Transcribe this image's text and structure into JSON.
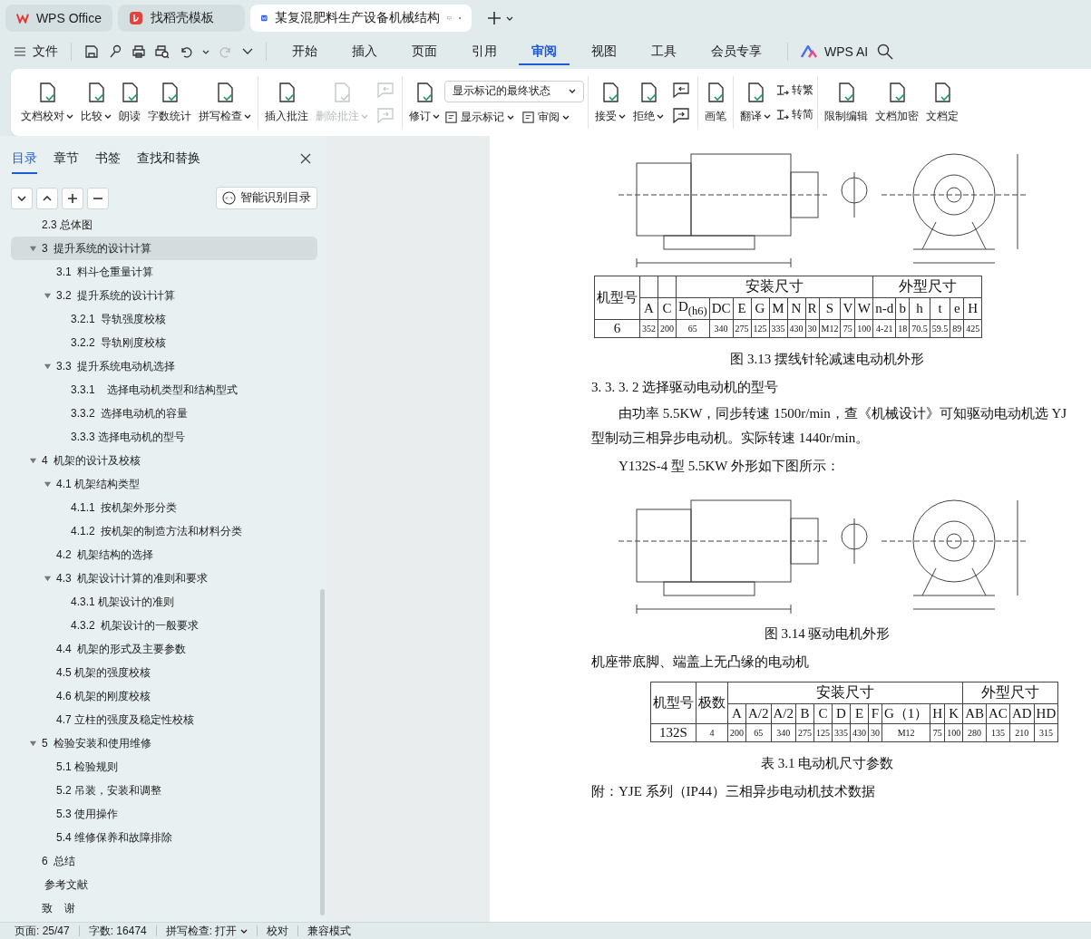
{
  "tabs": [
    {
      "label": "WPS Office",
      "kind": "home",
      "selected": false
    },
    {
      "label": "找稻壳模板",
      "kind": "template",
      "selected": false
    },
    {
      "label": "某复混肥料生产设备机械结构",
      "kind": "doc",
      "selected": true
    }
  ],
  "menu": {
    "file": "文件",
    "tabs": [
      {
        "label": "开始",
        "selected": false
      },
      {
        "label": "插入",
        "selected": false
      },
      {
        "label": "页面",
        "selected": false
      },
      {
        "label": "引用",
        "selected": false
      },
      {
        "label": "审阅",
        "selected": true
      },
      {
        "label": "视图",
        "selected": false
      },
      {
        "label": "工具",
        "selected": false
      },
      {
        "label": "会员专享",
        "selected": false
      }
    ],
    "ai": "WPS AI"
  },
  "ribbon": [
    {
      "items": [
        {
          "kind": "large",
          "label": "文档校对",
          "caret": true,
          "disabled": false
        },
        {
          "kind": "large",
          "label": "比较",
          "caret": true,
          "disabled": false
        },
        {
          "kind": "large",
          "label": "朗读",
          "caret": false,
          "disabled": false
        },
        {
          "kind": "large",
          "label": "字数统计",
          "caret": false,
          "disabled": false
        },
        {
          "kind": "large",
          "label": "拼写检查",
          "caret": true,
          "disabled": false
        }
      ]
    },
    {
      "items": [
        {
          "kind": "large",
          "label": "插入批注",
          "caret": false,
          "disabled": false
        },
        {
          "kind": "large",
          "label": "删除批注",
          "caret": true,
          "disabled": true
        },
        {
          "kind": "nav-pair",
          "disabled": true
        }
      ]
    },
    {
      "items": [
        {
          "kind": "large",
          "label": "修订",
          "caret": true,
          "disabled": false
        },
        {
          "kind": "markup",
          "select": "显示标记的最终状态",
          "buttons": [
            {
              "label": "显示标记",
              "caret": true
            },
            {
              "label": "审阅",
              "caret": true
            }
          ]
        }
      ]
    },
    {
      "items": [
        {
          "kind": "large",
          "label": "接受",
          "caret": true,
          "disabled": false
        },
        {
          "kind": "large",
          "label": "拒绝",
          "caret": true,
          "disabled": false
        },
        {
          "kind": "nav-pair",
          "disabled": false
        }
      ]
    },
    {
      "items": [
        {
          "kind": "large",
          "label": "画笔",
          "caret": false,
          "disabled": false
        }
      ]
    },
    {
      "items": [
        {
          "kind": "large",
          "label": "翻译",
          "caret": true,
          "disabled": false
        },
        {
          "kind": "convert",
          "buttons": [
            {
              "label": "转繁"
            },
            {
              "label": "转简"
            }
          ]
        }
      ]
    },
    {
      "items": [
        {
          "kind": "large",
          "label": "限制编辑",
          "caret": false,
          "disabled": false
        },
        {
          "kind": "large",
          "label": "文档加密",
          "caret": false,
          "disabled": false
        },
        {
          "kind": "large",
          "label": "文档定",
          "caret": false,
          "disabled": false
        }
      ]
    }
  ],
  "sidebar": {
    "tabs": [
      {
        "label": "目录",
        "selected": true
      },
      {
        "label": "章节",
        "selected": false
      },
      {
        "label": "书签",
        "selected": false
      },
      {
        "label": "查找和替换",
        "selected": false
      }
    ],
    "smart_button": "智能识别目录",
    "toc": [
      {
        "label": "2.3 总体图",
        "selected": false
      },
      {
        "label": "3  提升系统的设计计算",
        "selected": true,
        "expanded": true,
        "children": [
          {
            "label": "3.1  料斗仓重量计算",
            "selected": false
          },
          {
            "label": "3.2  提升系统的设计计算",
            "selected": false,
            "expanded": true,
            "children": [
              {
                "label": "3.2.1  导轨强度校核",
                "selected": false
              },
              {
                "label": "3.2.2  导轨刚度校核",
                "selected": false
              }
            ]
          },
          {
            "label": "3.3  提升系统电动机选择",
            "selected": false,
            "expanded": true,
            "children": [
              {
                "label": "3.3.1    选择电动机类型和结构型式",
                "selected": false
              },
              {
                "label": "3.3.2  选择电动机的容量",
                "selected": false
              },
              {
                "label": "3.3.3 选择电动机的型号",
                "selected": false
              }
            ]
          }
        ]
      },
      {
        "label": "4  机架的设计及校核",
        "selected": false,
        "expanded": true,
        "children": [
          {
            "label": "4.1 机架结构类型",
            "selected": false,
            "expanded": true,
            "children": [
              {
                "label": "4.1.1  按机架外形分类",
                "selected": false
              },
              {
                "label": "4.1.2  按机架的制造方法和材料分类",
                "selected": false
              }
            ]
          },
          {
            "label": "4.2  机架结构的选择",
            "selected": false
          },
          {
            "label": "4.3  机架设计计算的准则和要求",
            "selected": false,
            "expanded": true,
            "children": [
              {
                "label": "4.3.1 机架设计的准则",
                "selected": false
              },
              {
                "label": "4.3.2  机架设计的一般要求",
                "selected": false
              }
            ]
          },
          {
            "label": "4.4  机架的形式及主要参数",
            "selected": false
          },
          {
            "label": "4.5 机架的强度校核",
            "selected": false
          },
          {
            "label": "4.6 机架的刚度校核",
            "selected": false
          },
          {
            "label": "4.7 立柱的强度及稳定性校核",
            "selected": false
          }
        ]
      },
      {
        "label": "5  检验安装和使用维修",
        "selected": false,
        "expanded": true,
        "children": [
          {
            "label": "5.1 检验规则",
            "selected": false
          },
          {
            "label": "5.2 吊装，安装和调整",
            "selected": false
          },
          {
            "label": "5.3 使用操作",
            "selected": false
          },
          {
            "label": "5.4 维修保养和故障排除",
            "selected": false
          }
        ]
      },
      {
        "label": "6  总结",
        "selected": false
      },
      {
        "label": " 参考文献",
        "selected": false
      },
      {
        "label": "致    谢",
        "selected": false
      }
    ]
  },
  "document": [
    {
      "kind": "figure"
    },
    {
      "kind": "table",
      "row_headers": [
        "机型号"
      ],
      "column_groups": [
        {
          "columns": [
            "A",
            "C"
          ]
        },
        {
          "label": "安装尺寸",
          "columns": [
            "D$_{(h6)}$",
            "DC",
            "E",
            "G",
            "M",
            "N",
            "R",
            "S",
            "V",
            "W"
          ]
        },
        {
          "label": "外型尺寸",
          "columns": [
            "n-d",
            "b",
            "h",
            "t",
            "e",
            "H"
          ]
        }
      ],
      "rows": [
        [
          "6",
          "352",
          "200",
          "65",
          "340",
          "275",
          "125",
          "335",
          "430",
          "30",
          "M12",
          "75",
          "100",
          "4-21",
          "18",
          "70.5",
          "59.5",
          "89",
          "425"
        ]
      ]
    },
    {
      "kind": "caption",
      "text": "图 3.13 摆线针轮减速电动机外形"
    },
    {
      "kind": "heading",
      "text": "3. 3. 3. 2 选择驱动电动机的型号"
    },
    {
      "kind": "paragraph",
      "text": "由功率 5.5KW，同步转速 1500r/min，查《机械设计》可知驱动电动机选 YJ 型制动三相异步电动机。实际转速 1440r/min。"
    },
    {
      "kind": "paragraph",
      "text": "Y132S-4 型 5.5KW 外形如下图所示："
    },
    {
      "kind": "figure"
    },
    {
      "kind": "caption",
      "text": "图 3.14 驱动电机外形"
    },
    {
      "kind": "plain",
      "text": "机座带底脚、端盖上无凸缘的电动机"
    },
    {
      "kind": "table",
      "row_headers": [
        "机型号",
        "极数"
      ],
      "column_groups": [
        {
          "label": "安装尺寸",
          "columns": [
            "A",
            "A/2",
            "A/2",
            "B",
            "C",
            "D",
            "E",
            "F",
            "G（1）",
            "H",
            "K"
          ]
        },
        {
          "label": "外型尺寸",
          "columns": [
            "AB",
            "AC",
            "AD",
            "HD"
          ]
        }
      ],
      "rows": [
        [
          "132S",
          "4",
          "200",
          "65",
          "340",
          "275",
          "125",
          "335",
          "430",
          "30",
          "M12",
          "75",
          "100",
          "280",
          "135",
          "210",
          "315"
        ]
      ]
    },
    {
      "kind": "caption",
      "text": "表 3.1  电动机尺寸参数"
    },
    {
      "kind": "plain",
      "text": "附：YJE 系列（IP44）三相异步电动机技术数据"
    }
  ],
  "status_bar": [
    {
      "label": "页面: 25/47",
      "caret": false
    },
    {
      "label": "字数: 16474",
      "caret": false
    },
    {
      "label": "拼写检查: 打开",
      "caret": true
    },
    {
      "label": "校对",
      "caret": false
    },
    {
      "label": "兼容模式",
      "caret": false
    }
  ]
}
